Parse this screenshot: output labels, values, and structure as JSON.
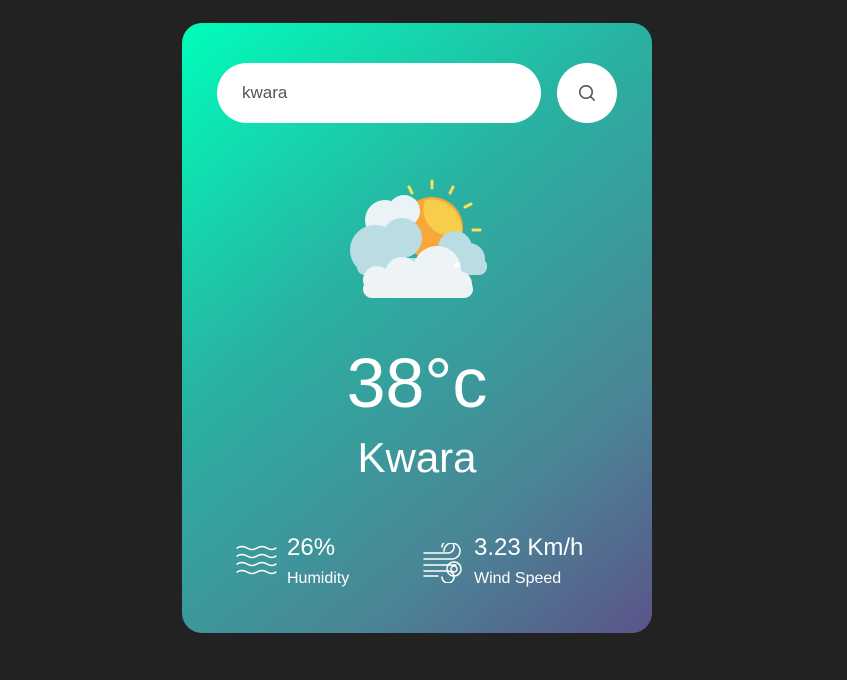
{
  "search": {
    "value": "kwara",
    "button_icon": "search-icon"
  },
  "weather": {
    "icon": "partly-cloudy-sun-icon",
    "temperature": "38°c",
    "city": "Kwara"
  },
  "details": {
    "humidity": {
      "icon": "humidity-waves-icon",
      "value": "26%",
      "label": "Humidity"
    },
    "wind": {
      "icon": "wind-icon",
      "value": "3.23 Km/h",
      "label": "Wind Speed"
    }
  },
  "colors": {
    "background": "#222222",
    "card_gradient_start": "#00feba",
    "card_gradient_end": "#5b548a",
    "text": "#ffffff"
  }
}
